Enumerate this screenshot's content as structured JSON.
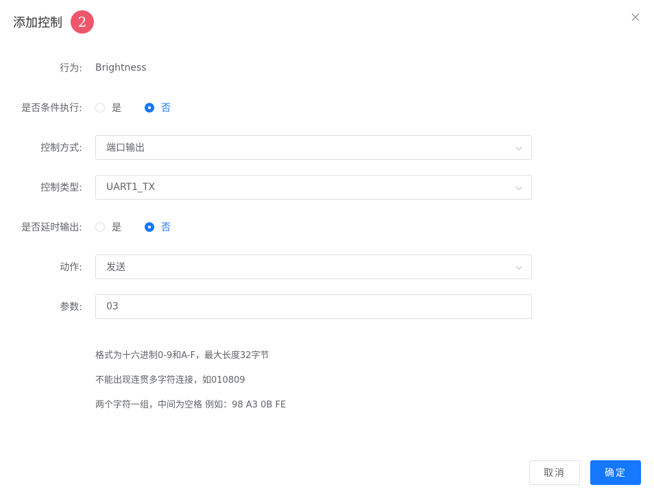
{
  "dialog": {
    "title": "添加控制",
    "step": "2"
  },
  "form": {
    "behavior": {
      "label": "行为:",
      "value": "Brightness"
    },
    "conditional": {
      "label": "是否条件执行:",
      "options": [
        {
          "label": "是",
          "checked": false
        },
        {
          "label": "否",
          "checked": true
        }
      ]
    },
    "control_mode": {
      "label": "控制方式:",
      "value": "端口输出"
    },
    "control_type": {
      "label": "控制类型:",
      "value": "UART1_TX"
    },
    "delay_output": {
      "label": "是否延时输出:",
      "options": [
        {
          "label": "是",
          "checked": false
        },
        {
          "label": "否",
          "checked": true
        }
      ]
    },
    "action": {
      "label": "动作:",
      "value": "发送"
    },
    "params": {
      "label": "参数:",
      "value": "03"
    }
  },
  "hints": [
    "格式为十六进制0-9和A-F，最大长度32字节",
    "不能出现连贯多字符连接，如010809",
    "两个字符一组，中间为空格 例如：98 A3 0B FE"
  ],
  "footer": {
    "cancel_label": "取消",
    "confirm_label": "确定"
  },
  "colors": {
    "primary": "#1677ff",
    "badge": "#f0566b",
    "border": "#dcdfe6",
    "text": "#606266"
  },
  "icons": {
    "close": "close-icon",
    "select_arrow": "chevron-down-icon"
  }
}
